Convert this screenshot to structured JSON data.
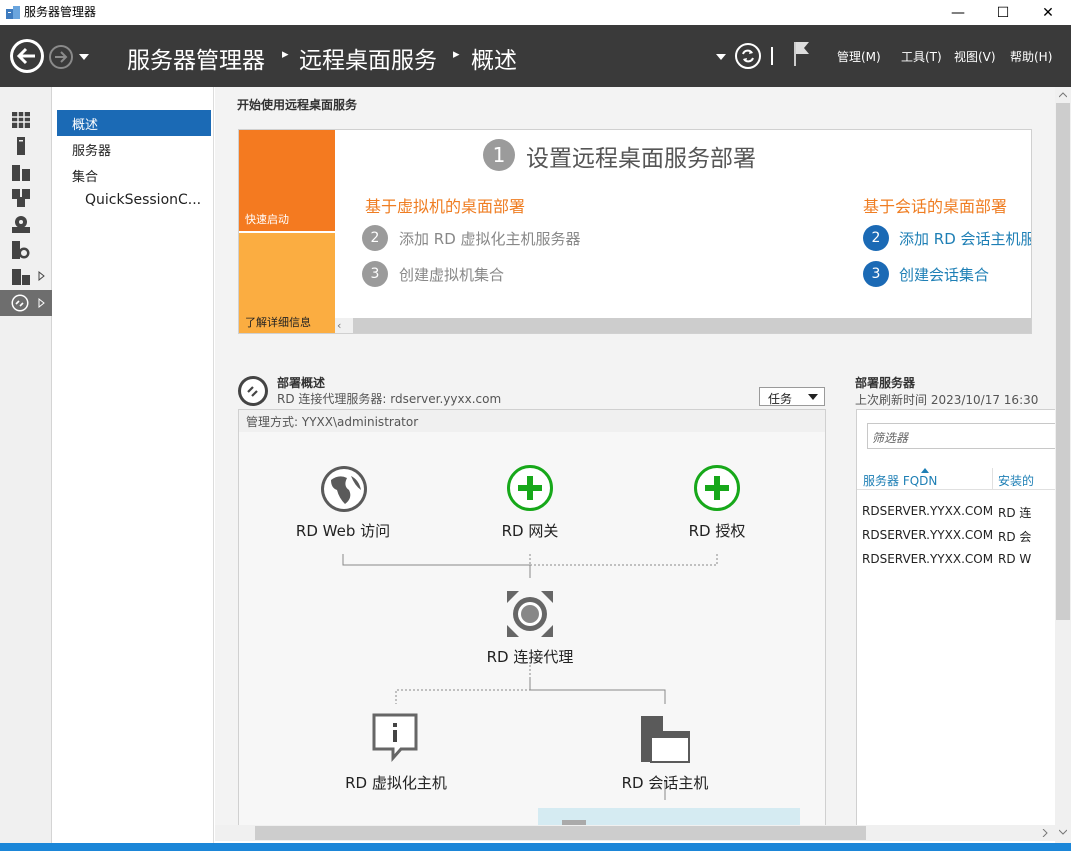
{
  "window": {
    "title": "服务器管理器",
    "minimize": "—",
    "maximize": "☐",
    "close": "✕"
  },
  "header": {
    "breadcrumb": [
      "服务器管理器",
      "远程桌面服务",
      "概述"
    ],
    "menus": [
      "管理(M)",
      "工具(T)",
      "视图(V)",
      "帮助(H)"
    ]
  },
  "nav": {
    "items": [
      {
        "label": "概述",
        "selected": true
      },
      {
        "label": "服务器",
        "selected": false
      },
      {
        "label": "集合",
        "selected": false
      },
      {
        "label": "QuickSessionC...",
        "selected": false
      }
    ]
  },
  "getting_started": {
    "heading": "开始使用远程桌面服务",
    "tile_quick": "快速启动",
    "tile_learn": "了解详细信息",
    "step1_num": "1",
    "step1_title": "设置远程桌面服务部署",
    "vm_heading": "基于虚拟机的桌面部署",
    "vm_steps": [
      {
        "num": "2",
        "label": "添加 RD 虚拟化主机服务器"
      },
      {
        "num": "3",
        "label": "创建虚拟机集合"
      }
    ],
    "session_heading": "基于会话的桌面部署",
    "session_steps": [
      {
        "num": "2",
        "label": "添加 RD 会话主机服务器"
      },
      {
        "num": "3",
        "label": "创建会话集合"
      }
    ]
  },
  "deployment": {
    "title": "部署概述",
    "broker_line": "RD 连接代理服务器: rdserver.yyxx.com",
    "tasks_label": "任务",
    "managed_by": "管理方式: YYXX\\administrator",
    "roles": {
      "web": "RD Web 访问",
      "gateway": "RD 网关",
      "licensing": "RD 授权",
      "broker": "RD 连接代理",
      "virtualization": "RD 虚拟化主机",
      "session": "RD 会话主机"
    }
  },
  "servers": {
    "title": "部署服务器",
    "refreshed": "上次刷新时间 2023/10/17 16:30",
    "filter_placeholder": "筛选器",
    "columns": [
      "服务器 FQDN",
      "安装的"
    ],
    "rows": [
      [
        "RDSERVER.YYXX.COM",
        "RD 连"
      ],
      [
        "RDSERVER.YYXX.COM",
        "RD 会"
      ],
      [
        "RDSERVER.YYXX.COM",
        "RD W"
      ]
    ]
  },
  "colors": {
    "accent_blue": "#1b6ab5",
    "orange_dark": "#f47a20",
    "orange_light": "#fbad41",
    "header_bg": "#3a3a3a",
    "green": "#17a81a"
  }
}
